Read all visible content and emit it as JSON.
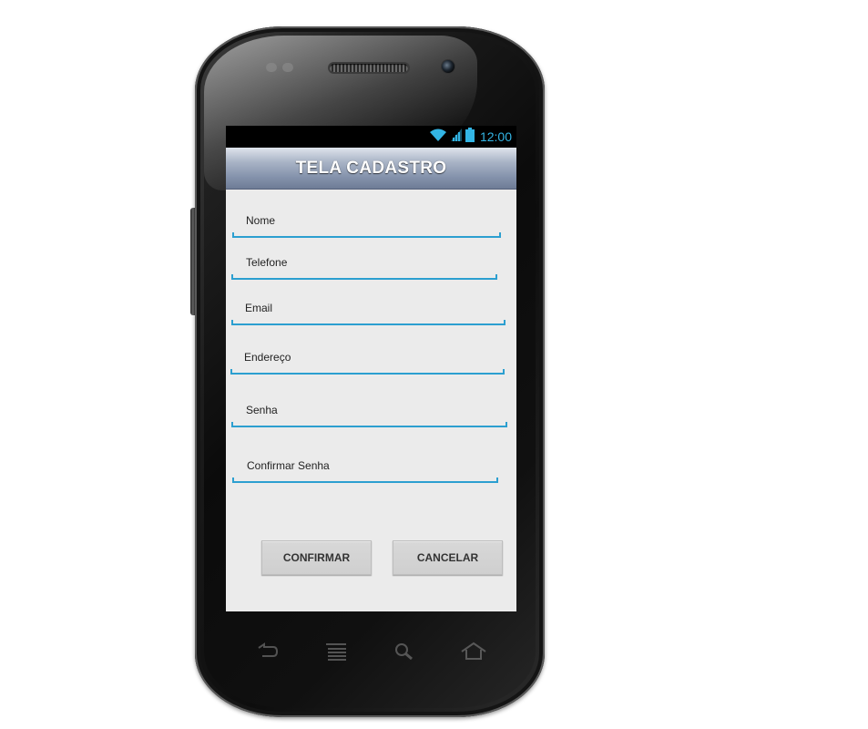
{
  "status_bar": {
    "time": "12:00",
    "icons": [
      "wifi-icon",
      "signal-icon",
      "battery-icon"
    ],
    "accent_color": "#33b5e5"
  },
  "header": {
    "title": "TELA CADASTRO"
  },
  "form": {
    "fields": [
      {
        "label": "Nome"
      },
      {
        "label": "Telefone"
      },
      {
        "label": "Email"
      },
      {
        "label": "Endereço"
      },
      {
        "label": "Senha"
      },
      {
        "label": "Confirmar Senha"
      }
    ],
    "underline_color": "#2c9fd0"
  },
  "buttons": {
    "confirm_label": "CONFIRMAR",
    "cancel_label": "CANCELAR"
  },
  "nav_keys": [
    "back-icon",
    "menu-icon",
    "search-icon",
    "home-icon"
  ]
}
